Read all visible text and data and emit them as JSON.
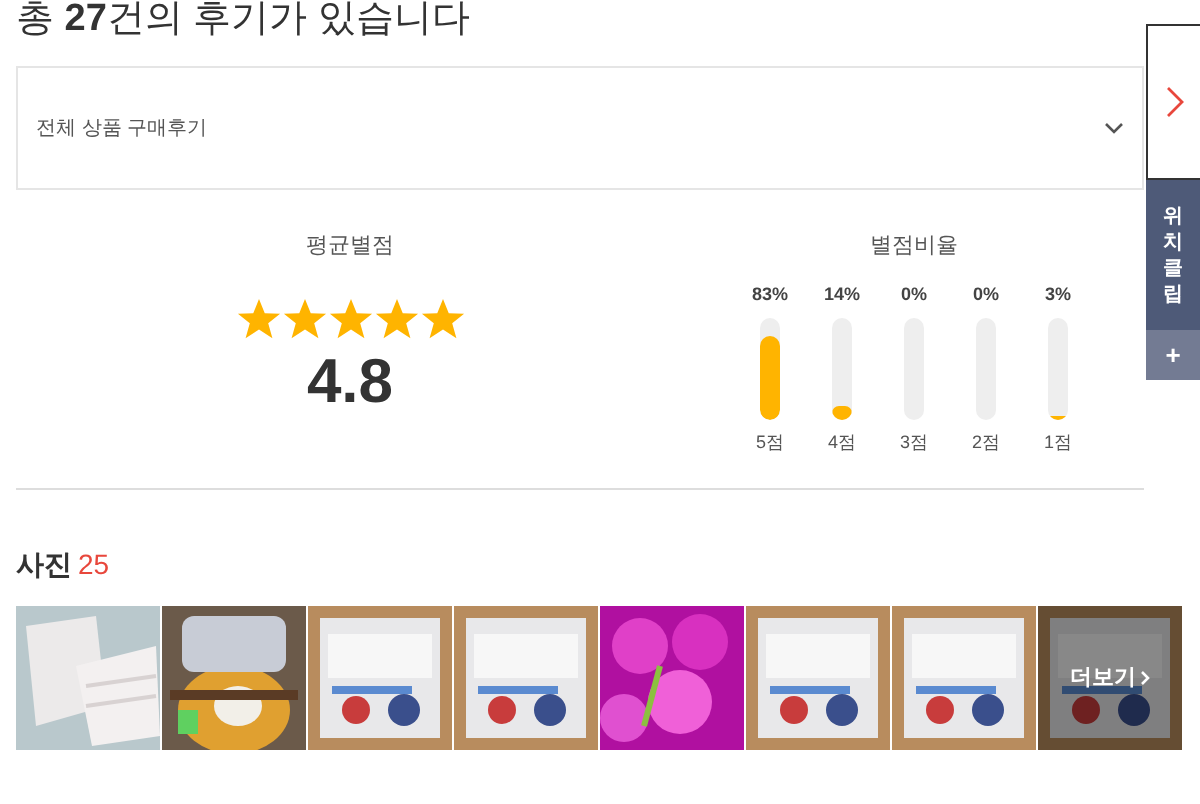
{
  "heading": "총 **27**건의 후기가 있습니다",
  "filter": {
    "value": "전체 상품 구매후기"
  },
  "average": {
    "title": "평균별점",
    "stars": 5,
    "score": "4.8"
  },
  "ratio": {
    "title": "별점비율",
    "bars": [
      {
        "percent": "83%",
        "level": 0.83,
        "label": "5점"
      },
      {
        "percent": "14%",
        "level": 0.14,
        "label": "4점"
      },
      {
        "percent": "0%",
        "level": 0,
        "label": "3점"
      },
      {
        "percent": "0%",
        "level": 0,
        "label": "2점"
      },
      {
        "percent": "3%",
        "level": 0.03,
        "label": "1점"
      }
    ]
  },
  "photos": {
    "title": "사진",
    "count": "25",
    "items": [
      {
        "kind": "picture"
      },
      {
        "kind": "picture"
      },
      {
        "kind": "picture"
      },
      {
        "kind": "picture"
      },
      {
        "kind": "picture"
      },
      {
        "kind": "picture"
      },
      {
        "kind": "picture"
      },
      {
        "kind": "more",
        "label": "더보기"
      }
    ]
  },
  "side_panel": {
    "label": "위치클립",
    "plus": "+"
  }
}
